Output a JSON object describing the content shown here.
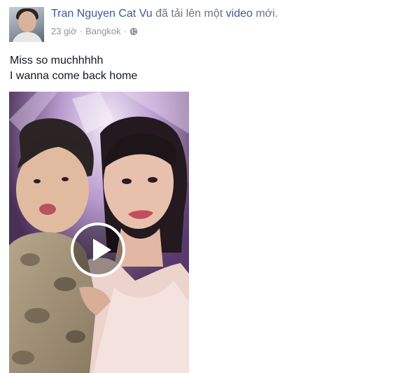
{
  "post": {
    "author": "Tran Nguyen Cat Vu",
    "action_text": "đã tải lên một",
    "action_link": "video",
    "action_suffix": "mới.",
    "time": "23 giờ",
    "separator": "·",
    "location": "Bangkok",
    "privacy_icon": "globe-icon",
    "text_lines": [
      "Miss so muchhhhh",
      "I wanna come back home"
    ]
  },
  "video": {
    "play_icon": "play-icon"
  },
  "colors": {
    "link": "#3b5998",
    "meta": "#90949c",
    "text": "#141823"
  }
}
